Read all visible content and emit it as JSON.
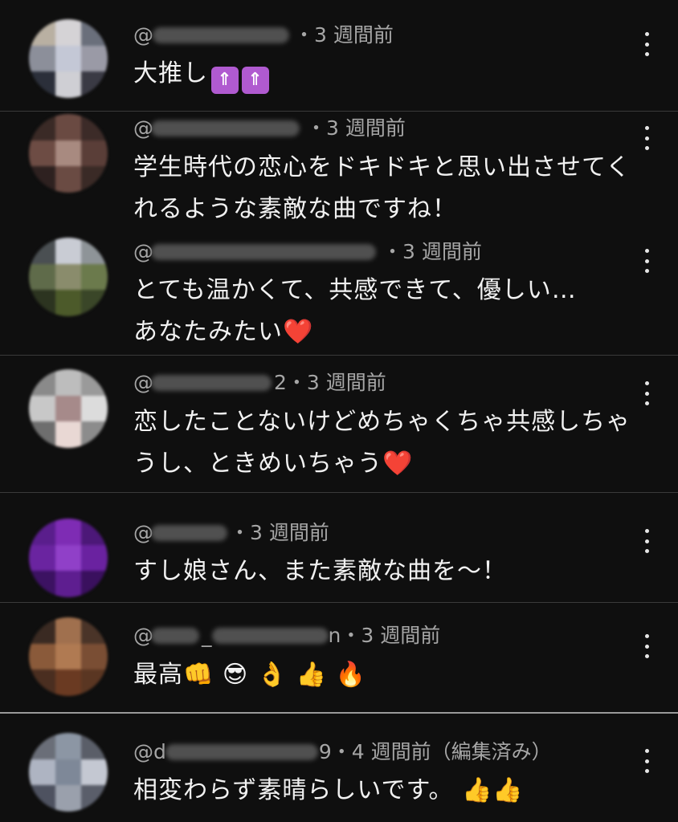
{
  "comments": [
    {
      "handle_visible": "@",
      "handle_tail": "",
      "time": "・3 週間前",
      "text": "大推し",
      "text2": "",
      "emoji": [
        "🛐",
        "🛐"
      ]
    },
    {
      "handle_visible": "@",
      "handle_tail": "",
      "time": "・3 週間前",
      "text": "学生時代の恋心をドキドキと思い出させてく",
      "text2": "れるような素敵な曲ですね！"
    },
    {
      "handle_visible": "@",
      "handle_tail": "",
      "time": "・3 週間前",
      "text": "とても温かくて、共感できて、優しい…",
      "text2": "あなたみたい",
      "emoji2": "❤️"
    },
    {
      "handle_visible": "@",
      "handle_tail": "2",
      "time": "・3 週間前",
      "text": "恋したことないけどめちゃくちゃ共感しちゃ",
      "text2": "うし、ときめいちゃう",
      "emoji2": "❤️"
    },
    {
      "handle_visible": "@",
      "handle_tail": "",
      "time": "・3 週間前",
      "text": "すし娘さん、また素敵な曲を〜！"
    },
    {
      "handle_visible": "@",
      "handle_tail": "_",
      "handle_tail2": "n",
      "time": "・3 週間前",
      "text": "最高",
      "emoji": [
        "👊",
        "😎",
        "👌",
        "👍",
        "🔥"
      ]
    },
    {
      "handle_visible": "@d",
      "handle_tail": "9",
      "time": "・4 週間前（編集済み）",
      "text": "相変わらず素晴らしいです。",
      "emoji": [
        "👍",
        "👍"
      ]
    }
  ],
  "colors": {
    "background": "#0f0f0f",
    "text": "#f1f1f1",
    "meta": "#a6a6a6",
    "divider": "#3a3a3a"
  },
  "icons": {
    "more": "vertical-three-dots-icon"
  }
}
